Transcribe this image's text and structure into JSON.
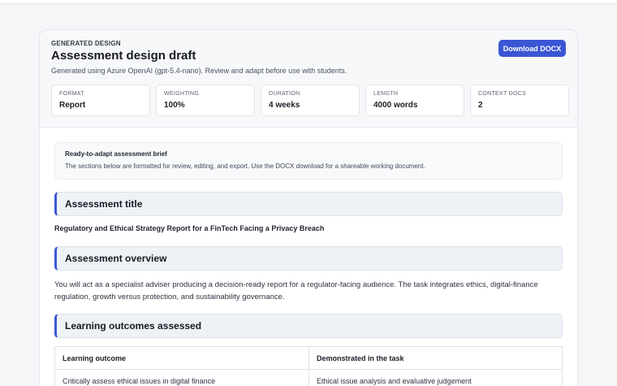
{
  "header": {
    "eyebrow": "GENERATED DESIGN",
    "title": "Assessment design draft",
    "subtitle": "Generated using Azure OpenAI (gpt-5.4-nano). Review and adapt before use with students.",
    "download_label": "Download DOCX"
  },
  "stats": [
    {
      "label": "FORMAT",
      "value": "Report"
    },
    {
      "label": "WEIGHTING",
      "value": "100%"
    },
    {
      "label": "DURATION",
      "value": "4 weeks"
    },
    {
      "label": "LENGTH",
      "value": "4000 words"
    },
    {
      "label": "CONTEXT DOCS",
      "value": "2"
    }
  ],
  "brief": {
    "title": "Ready-to-adapt assessment brief",
    "text": "The sections below are formatted for review, editing, and export. Use the DOCX download for a shareable working document."
  },
  "sections": {
    "assessment_title": {
      "heading": "Assessment title",
      "text": "Regulatory and Ethical Strategy Report for a FinTech Facing a Privacy Breach"
    },
    "overview": {
      "heading": "Assessment overview",
      "text": "You will act as a specialist adviser producing a decision-ready report for a regulator-facing audience. The task integrates ethics, digital-finance regulation, growth versus protection, and sustainability governance."
    },
    "learning_outcomes": {
      "heading": "Learning outcomes assessed",
      "columns": [
        "Learning outcome",
        "Demonstrated in the task"
      ],
      "rows": [
        [
          "Critically assess ethical issues in digital finance",
          "Ethical issue analysis and evaluative judgement"
        ]
      ]
    }
  },
  "colors": {
    "accent": "#3a56d4",
    "background": "#f5f6f8"
  }
}
